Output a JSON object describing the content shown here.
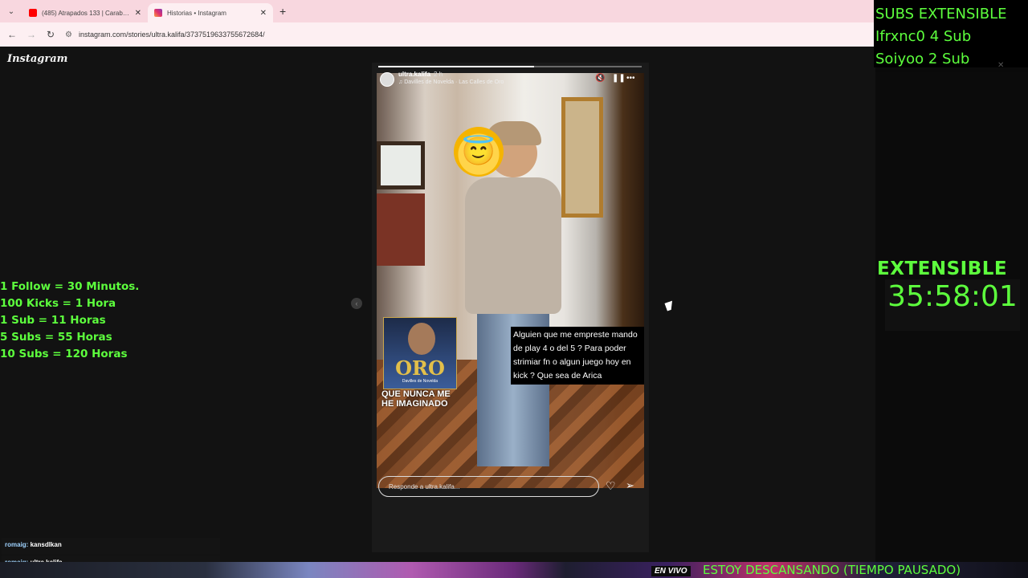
{
  "browser": {
    "tabs": [
      {
        "title": "(485) Atrapados 133 | Carabine",
        "favicon_color": "#ff0000",
        "active": false
      },
      {
        "title": "Historias • Instagram",
        "favicon_color": "#e1306c",
        "active": true
      }
    ],
    "url": "instagram.com/stories/ultra.kalifa/3737519633755672684/"
  },
  "instagram": {
    "logo": "Instagram",
    "story": {
      "username": "ultra.kalifa",
      "time": "2 h",
      "music": "Davilles de Novelda · Las Calles de Oro",
      "progress": 0.59,
      "album_title": "ORO",
      "album_sub": "Davilles de Novelda",
      "lyric": "QUE NUNCA ME HE IMAGINADO",
      "caption": "Alguien que me empreste mando de play 4 o del 5 ? Para poder strimiar fn o algun juego hoy en kick ? Que sea de Arica"
    },
    "reply_placeholder": "Responde a ultra.kalifa..."
  },
  "overlay": {
    "subs_lines": [
      "SUBS EXTENSIBLE",
      "Ifrxnc0 4 Sub",
      "Soiyoo 2 Sub"
    ],
    "timer_title": "EXTENSIBLE",
    "timer": "35:58:01",
    "rules": [
      "1 Follow = 30 Minutos.",
      "100 Kicks = 1 Hora",
      "1 Sub = 11 Horas",
      "5 Subs = 55 Horas",
      "10 Subs = 120 Horas"
    ],
    "chat": [
      {
        "user": "romaig:",
        "message": "kansdlkan"
      },
      {
        "user": "romaig:",
        "message": "ultra.kalifa"
      }
    ],
    "live_badge": "EN VIVO",
    "ticker": "ESTOY DESCANSANDO (TIEMPO PAUSADO)"
  },
  "colors": {
    "accent_green": "#5dff3d",
    "tabbar": "#f8d7df"
  }
}
